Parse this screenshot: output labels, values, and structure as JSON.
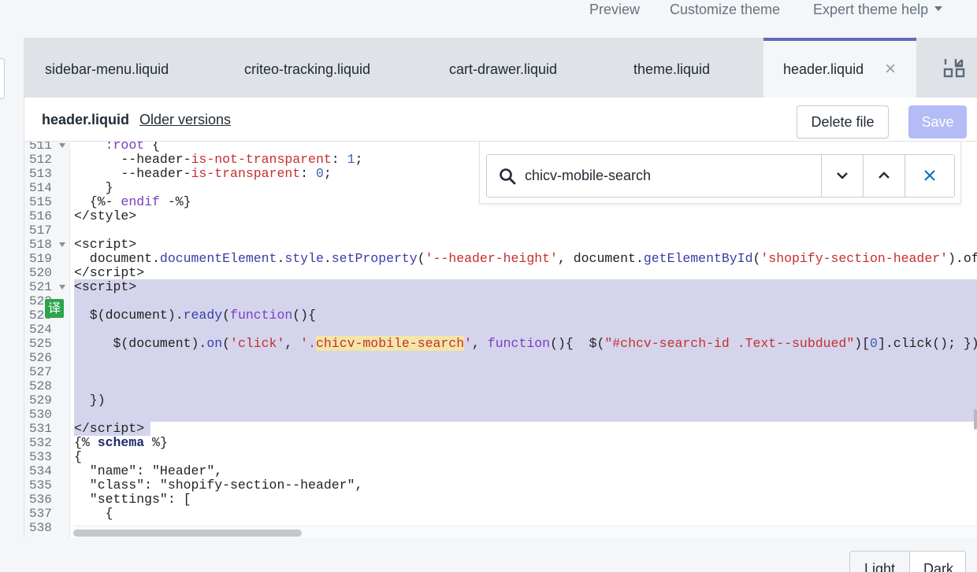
{
  "topbar": {
    "preview": "Preview",
    "customize": "Customize theme",
    "expert_help": "Expert theme help"
  },
  "tabs": [
    {
      "label": "sidebar-menu.liquid"
    },
    {
      "label": "criteo-tracking.liquid"
    },
    {
      "label": "cart-drawer.liquid"
    },
    {
      "label": "theme.liquid"
    },
    {
      "label": "header.liquid",
      "active": true
    }
  ],
  "file": {
    "name": "header.liquid",
    "older_versions": "Older versions",
    "delete_label": "Delete file",
    "save_label": "Save"
  },
  "search": {
    "value": "chicv-mobile-search"
  },
  "editor": {
    "selection_color": "#d4d5ec",
    "match_color": "#f3e6a8",
    "translate_badge": "译",
    "line_numbers": [
      "511",
      "512",
      "513",
      "514",
      "515",
      "516",
      "517",
      "518",
      "519",
      "520",
      "521",
      "522",
      "523",
      "524",
      "525",
      "526",
      "527",
      "528",
      "529",
      "530",
      "531",
      "532",
      "533",
      "534",
      "535",
      "536",
      "537",
      "538"
    ],
    "folded_lines": [
      "511",
      "518",
      "521"
    ]
  },
  "theme_toggle": {
    "light": "Light",
    "dark": "Dark"
  },
  "colors": {
    "accent": "#5c6ac4",
    "save_disabled": "#b3bcf5"
  }
}
